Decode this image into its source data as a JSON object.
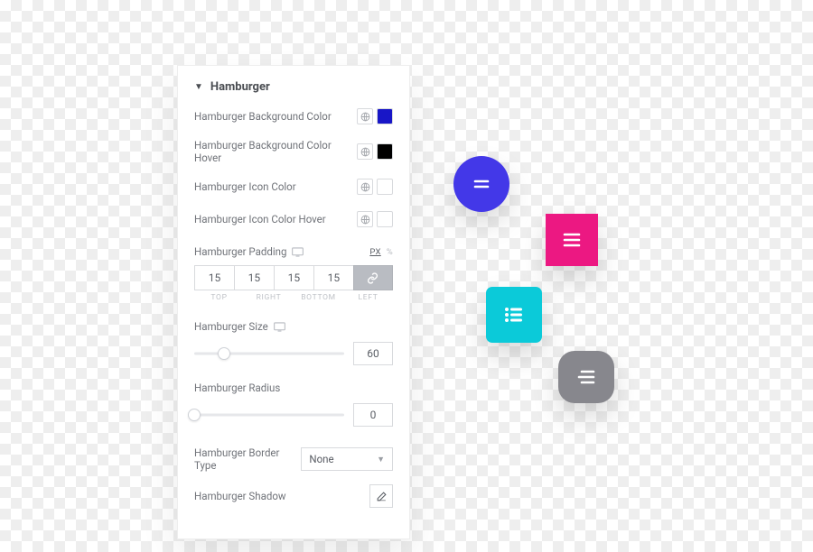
{
  "section": {
    "title": "Hamburger"
  },
  "controls": {
    "bg_color": {
      "label": "Hamburger Background Color",
      "value": "#1816c7"
    },
    "bg_color_hover": {
      "label": "Hamburger Background Color Hover",
      "value": "#000000"
    },
    "icon_color": {
      "label": "Hamburger Icon Color",
      "value": ""
    },
    "icon_color_hover": {
      "label": "Hamburger Icon Color Hover",
      "value": ""
    },
    "padding": {
      "label": "Hamburger Padding",
      "unit_active": "PX",
      "unit_other": "%",
      "values": {
        "top": "15",
        "right": "15",
        "bottom": "15",
        "left": "15"
      },
      "side_labels": {
        "top": "TOP",
        "right": "RIGHT",
        "bottom": "BOTTOM",
        "left": "LEFT"
      },
      "linked": true
    },
    "size": {
      "label": "Hamburger Size",
      "value": "60",
      "min": 0,
      "max": 300
    },
    "radius": {
      "label": "Hamburger Radius",
      "value": "0",
      "min": 0,
      "max": 100
    },
    "border_type": {
      "label": "Hamburger Border Type",
      "selected": "None"
    },
    "shadow": {
      "label": "Hamburger Shadow"
    }
  },
  "samples": {
    "circle_blue": "#4338e8",
    "square_pink": "#ec1882",
    "rounded_cyan": "#0bcad9",
    "pill_gray": "#87878d"
  }
}
